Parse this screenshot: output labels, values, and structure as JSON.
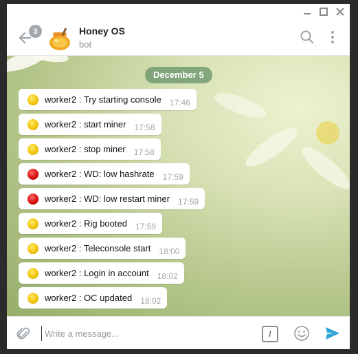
{
  "window": {
    "controls": {
      "minimize_icon": "minimize-icon",
      "maximize_icon": "maximize-icon",
      "close_icon": "close-icon"
    }
  },
  "header": {
    "unread_count": "3",
    "title": "Honey OS",
    "subtitle": "bot"
  },
  "chat": {
    "date_separator": "December 5",
    "messages": [
      {
        "status": "yellow",
        "text": "worker2 : Try starting console",
        "time": "17:46"
      },
      {
        "status": "yellow",
        "text": "worker2 : start miner",
        "time": "17:58"
      },
      {
        "status": "yellow",
        "text": "worker2 : stop miner",
        "time": "17:58"
      },
      {
        "status": "red",
        "text": "worker2 : WD: low hashrate",
        "time": "17:59"
      },
      {
        "status": "red",
        "text": "worker2 : WD: low restart miner",
        "time": "17:59"
      },
      {
        "status": "yellow",
        "text": "worker2 : Rig booted",
        "time": "17:59"
      },
      {
        "status": "yellow",
        "text": "worker2 : Teleconsole start",
        "time": "18:00"
      },
      {
        "status": "yellow",
        "text": "worker2 : Login in account",
        "time": "18:02"
      },
      {
        "status": "yellow",
        "text": "worker2 : OC updated",
        "time": "18:02"
      }
    ]
  },
  "composer": {
    "placeholder": "Write a message...",
    "value": "",
    "commands_label": "/"
  },
  "colors": {
    "accent": "#2ea6d8",
    "date_pill": "#6e966e",
    "status_yellow": "#f2c40c",
    "status_red": "#d60f0f"
  }
}
